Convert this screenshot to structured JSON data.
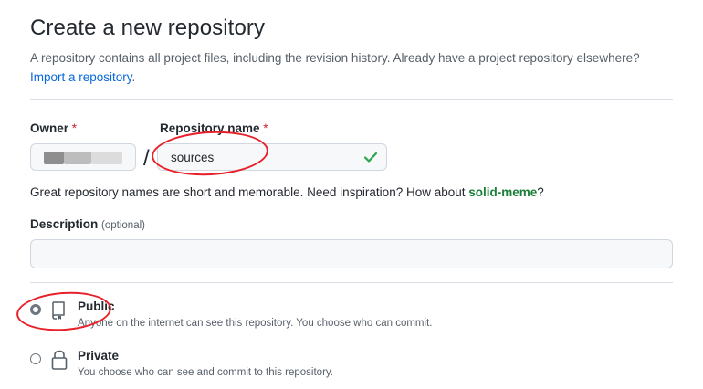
{
  "header": {
    "title": "Create a new repository",
    "subtitle": "A repository contains all project files, including the revision history. Already have a project repository elsewhere?",
    "import_link": "Import a repository",
    "import_suffix": "."
  },
  "owner": {
    "label": "Owner",
    "required_mark": "*"
  },
  "separator": "/",
  "repo_name": {
    "label": "Repository name",
    "required_mark": "*",
    "value": "sources",
    "status_icon": "check-icon",
    "status_color": "#2da44e"
  },
  "name_hint": {
    "text": "Great repository names are short and memorable. Need inspiration? How about ",
    "suggestion": "solid-meme",
    "suffix": "?"
  },
  "description": {
    "label": "Description",
    "optional": "(optional)",
    "value": ""
  },
  "visibility": {
    "options": [
      {
        "title": "Public",
        "desc": "Anyone on the internet can see this repository. You choose who can commit.",
        "icon": "repo-icon",
        "selected": true
      },
      {
        "title": "Private",
        "desc": "You choose who can see and commit to this repository.",
        "icon": "lock-icon",
        "selected": false
      }
    ]
  },
  "annotation_color": "#e8202a"
}
